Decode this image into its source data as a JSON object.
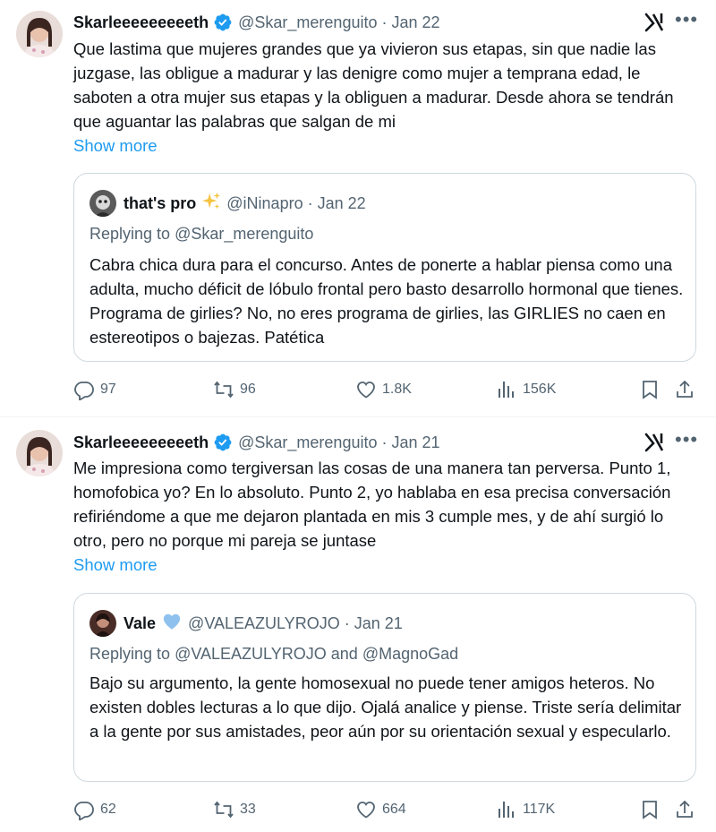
{
  "tweets": [
    {
      "author_name": "Skarleeeeeeeeeth",
      "handle": "@Skar_merenguito",
      "date": "Jan 22",
      "text": "Que lastima que mujeres grandes que ya vivieron sus etapas, sin que nadie las juzgase, las obligue a madurar y las denigre como mujer a temprana edad, le saboten a otra mujer sus etapas y la obliguen a madurar. Desde ahora se tendrán que aguantar las palabras que salgan de mi",
      "show_more": "Show more",
      "quote": {
        "author_name": "that's pro",
        "handle": "@iNinapro",
        "date": "Jan 22",
        "replying_prefix": "Replying to",
        "replying_to": "@Skar_merenguito",
        "replying_and": "",
        "replying_to_2": "",
        "text": "Cabra chica dura para el concurso. Antes de ponerte a hablar piensa como una adulta, mucho déficit de lóbulo frontal pero basto desarrollo hormonal que tienes. Programa de girlies? No, no eres programa  de girlies, las GIRLIES no caen en estereotipos o bajezas. Patética"
      },
      "replies": "97",
      "reposts": "96",
      "likes": "1.8K",
      "views": "156K"
    },
    {
      "author_name": "Skarleeeeeeeeeth",
      "handle": "@Skar_merenguito",
      "date": "Jan 21",
      "text": "Me impresiona como tergiversan las cosas de una manera tan perversa. Punto 1, homofobica yo? En lo absoluto. Punto 2, yo hablaba en esa precisa conversación refiriéndome a que me dejaron plantada en mis 3 cumple mes, y de ahí surgió lo otro, pero no porque mi pareja se juntase",
      "show_more": "Show more",
      "quote": {
        "author_name": "Vale",
        "handle": "@VALEAZULYROJO",
        "date": "Jan 21",
        "replying_prefix": "Replying to",
        "replying_to": "@VALEAZULYROJO",
        "replying_and": "and",
        "replying_to_2": "@MagnoGad",
        "text": "Bajo su argumento, la gente homosexual no puede tener amigos heteros. No existen dobles lecturas a lo que dijo. Ojalá analice y piense. Triste sería delimitar a la gente por sus amistades, peor aún por su orientación sexual y especularlo."
      },
      "replies": "62",
      "reposts": "33",
      "likes": "664",
      "views": "117K"
    }
  ],
  "colors": {
    "text": "#0f1419",
    "secondary": "#536471",
    "accent": "#1d9bf0",
    "border": "#cfd9de"
  },
  "icons": {
    "verified": "verified-badge-icon",
    "grok": "grok-icon",
    "more": "more-icon",
    "reply": "reply-icon",
    "repost": "repost-icon",
    "like": "like-icon",
    "views": "views-icon",
    "bookmark": "bookmark-icon",
    "share": "share-icon",
    "sparkles": "sparkles-icon",
    "blue_heart": "blue-heart-icon"
  }
}
